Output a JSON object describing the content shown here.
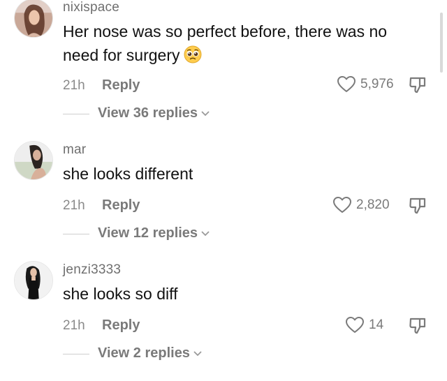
{
  "comments": [
    {
      "username": "nixispace",
      "text": "Her nose was so perfect before, there was no need for surgery",
      "time": "21h",
      "reply_label": "Reply",
      "likes": "5,976",
      "view_replies": "View 36 replies"
    },
    {
      "username": "mar",
      "text": "she looks different",
      "time": "21h",
      "reply_label": "Reply",
      "likes": "2,820",
      "view_replies": "View 12 replies"
    },
    {
      "username": "jenzi3333",
      "text": "she looks so diff",
      "time": "21h",
      "reply_label": "Reply",
      "likes": "14",
      "view_replies": "View 2 replies"
    }
  ],
  "icons": {
    "like": "heart-outline-icon",
    "dislike": "thumbs-down-icon",
    "expand": "chevron-down-icon",
    "emoji": "pleading-face-emoji"
  },
  "colors": {
    "text": "#111111",
    "secondary": "#7a7a7a",
    "username": "#6f6f6f"
  }
}
